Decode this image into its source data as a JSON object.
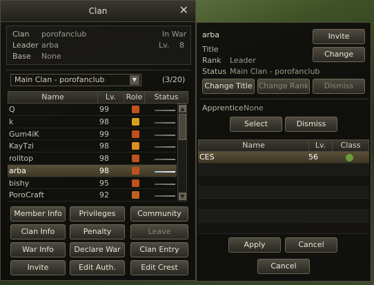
{
  "window": {
    "title": "Clan",
    "close_glyph": "✕"
  },
  "info": {
    "clan_label": "Clan",
    "clan_value": "porofanclub",
    "leader_label": "Leader",
    "leader_value": "arba",
    "base_label": "Base",
    "base_value": "None",
    "war_status": "In War",
    "level_label": "Lv.",
    "level_value": "8"
  },
  "dropdown": {
    "selected": "Main Clan - porofanclub",
    "count": "(3/20)"
  },
  "member_table": {
    "headers": {
      "name": "Name",
      "level": "Lv.",
      "role": "Role",
      "status": "Status"
    },
    "rows": [
      {
        "name": "Q",
        "level": "99",
        "role_color": "#c05020",
        "online": false
      },
      {
        "name": "k",
        "level": "98",
        "role_color": "#d8a020",
        "online": false
      },
      {
        "name": "Gum4iK",
        "level": "99",
        "role_color": "#c05020",
        "online": false
      },
      {
        "name": "KayTzi",
        "level": "98",
        "role_color": "#d89020",
        "online": false
      },
      {
        "name": "rolltop",
        "level": "98",
        "role_color": "#c05020",
        "online": false
      },
      {
        "name": "arba",
        "level": "98",
        "role_color": "#c05020",
        "online": true,
        "selected": true
      },
      {
        "name": "bishy",
        "level": "95",
        "role_color": "#c05020",
        "online": false
      },
      {
        "name": "PoroCraft",
        "level": "92",
        "role_color": "#c06020",
        "online": false
      }
    ]
  },
  "buttons": {
    "member_info": "Member Info",
    "privileges": "Privileges",
    "community": "Community",
    "clan_info": "Clan Info",
    "penalty": "Penalty",
    "leave": "Leave",
    "war_info": "War Info",
    "declare_war": "Declare War",
    "clan_entry": "Clan Entry",
    "invite": "Invite",
    "edit_auth": "Edit Auth.",
    "edit_crest": "Edit Crest"
  },
  "member_detail": {
    "name": "arba",
    "title_label": "Title",
    "title_value": "",
    "rank_label": "Rank",
    "rank_value": "Leader",
    "status_label": "Status",
    "status_value": "Main Clan - porofanclub",
    "invite_button": "Invite",
    "change_button": "Change",
    "change_title_button": "Change Title",
    "change_rank_button": "Change Rank",
    "dismiss_button": "Dismiss"
  },
  "apprentice": {
    "label": "Apprentice",
    "value": "None",
    "select_button": "Select",
    "dismiss_button": "Dismiss"
  },
  "apprentice_table": {
    "headers": {
      "name": "Name",
      "level": "Lv.",
      "class": "Class"
    },
    "rows": [
      {
        "name": "CES",
        "level": "56"
      }
    ]
  },
  "footer": {
    "apply": "Apply",
    "cancel": "Cancel",
    "cancel_main": "Cancel"
  }
}
